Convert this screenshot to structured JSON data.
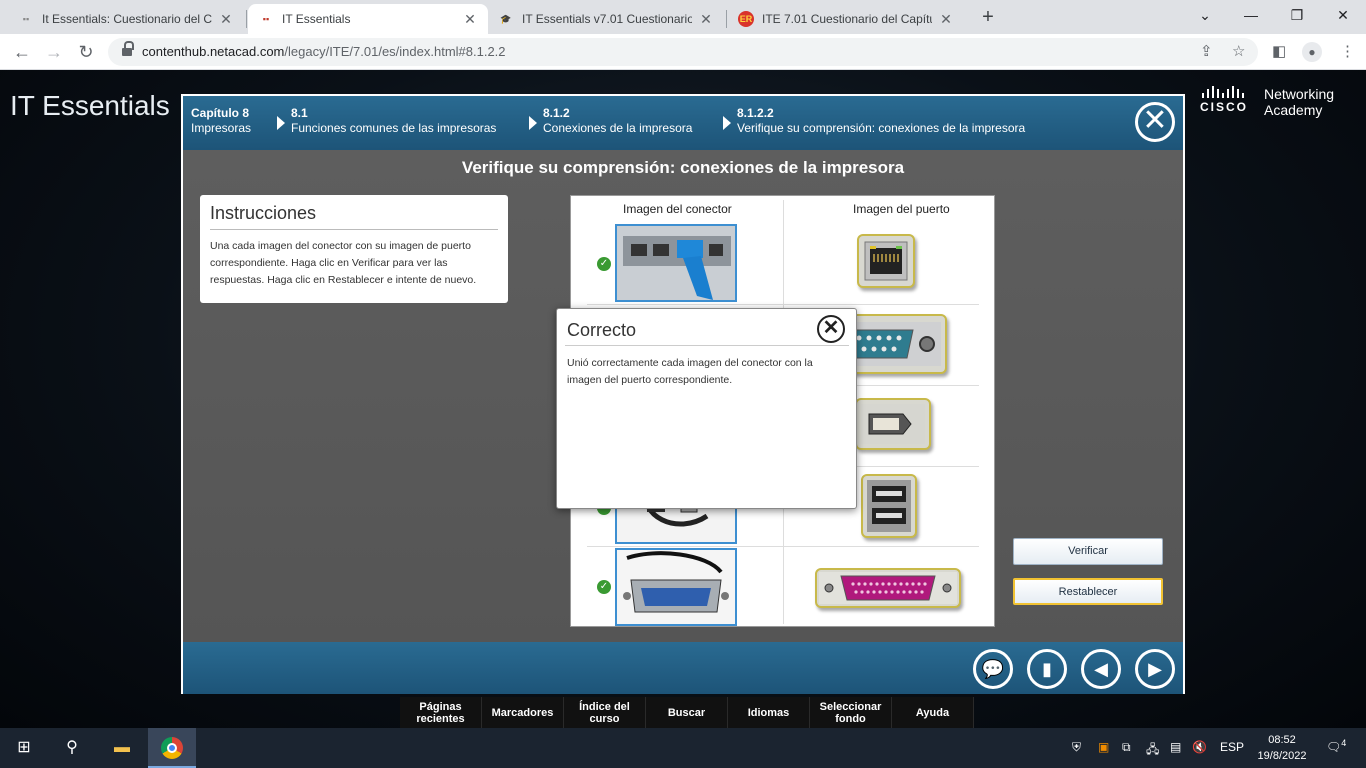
{
  "browser": {
    "tabs": [
      {
        "title": "It Essentials: Cuestionario del Cap",
        "active": false
      },
      {
        "title": "IT Essentials",
        "active": true
      },
      {
        "title": "IT Essentials v7.01 Cuestionario C",
        "active": false
      },
      {
        "title": "ITE 7.01 Cuestionario del Capítulo",
        "active": false
      }
    ],
    "url_host": "contenthub.netacad.com",
    "url_path": "/legacy/ITE/7.01/es/index.html#8.1.2.2"
  },
  "header": {
    "app_title": "IT Essentials",
    "logo_word": "CISCO",
    "logo_tagline": "Networking Academy"
  },
  "breadcrumb": {
    "chapter_label": "Capítulo 8",
    "chapter_name": "Impresoras",
    "items": [
      {
        "num": "8.1",
        "name": "Funciones comunes de las impresoras"
      },
      {
        "num": "8.1.2",
        "name": "Conexiones de la impresora"
      },
      {
        "num": "8.1.2.2",
        "name": "Verifique su comprensión: conexiones de la impresora"
      }
    ]
  },
  "activity": {
    "title": "Verifique su comprensión: conexiones de la impresora",
    "instructions_title": "Instrucciones",
    "instructions_text": "Una cada imagen del conector con su imagen de puerto correspondiente. Haga clic en Verificar para ver las respuestas. Haga clic en Restablecer e intente de nuevo.",
    "col_connector": "Imagen del conector",
    "col_port": "Imagen del puerto",
    "verify_label": "Verificar",
    "reset_label": "Restablecer"
  },
  "popup": {
    "title": "Correcto",
    "message": "Unió correctamente cada imagen del conector con la imagen del puerto correspondiente."
  },
  "bottom_nav": [
    "Páginas recientes",
    "Marcadores",
    "Índice del curso",
    "Buscar",
    "Idiomas",
    "Seleccionar fondo",
    "Ayuda"
  ],
  "taskbar": {
    "language": "ESP",
    "time": "08:52",
    "date": "19/8/2022",
    "notifications": "4"
  }
}
